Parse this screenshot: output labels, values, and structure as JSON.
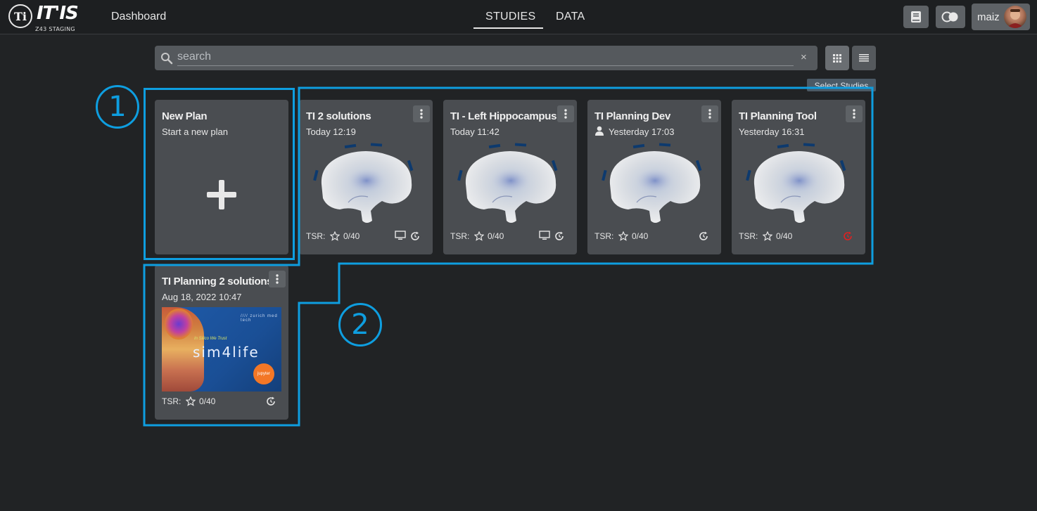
{
  "header": {
    "logo_sub": "Z43 STAGING",
    "logo_mark": "Ti",
    "logo_text": "IT'IS",
    "dashboard_label": "Dashboard",
    "tabs": [
      {
        "label": "STUDIES",
        "active": true
      },
      {
        "label": "DATA",
        "active": false
      }
    ],
    "user_name": "maiz"
  },
  "search": {
    "placeholder": "search",
    "value": "",
    "clear_label": "×"
  },
  "view": {
    "tooltip": "Select Studies",
    "mode": "grid"
  },
  "new_plan": {
    "title": "New Plan",
    "subtitle": "Start a new plan"
  },
  "studies": [
    {
      "title": "TI 2 solutions",
      "date": "Today 12:19",
      "tsr_label": "TSR:",
      "tsr": "0/40",
      "shared": false,
      "monitor": true,
      "status_color": "#e6e6e6"
    },
    {
      "title": "TI - Left Hippocampus",
      "date": "Today 11:42",
      "tsr_label": "TSR:",
      "tsr": "0/40",
      "shared": false,
      "monitor": true,
      "status_color": "#e6e6e6"
    },
    {
      "title": "TI Planning Dev",
      "date": "Yesterday 17:03",
      "tsr_label": "TSR:",
      "tsr": "0/40",
      "shared": true,
      "monitor": false,
      "status_color": "#e6e6e6"
    },
    {
      "title": "TI Planning Tool",
      "date": "Yesterday 16:31",
      "tsr_label": "TSR:",
      "tsr": "0/40",
      "shared": false,
      "monitor": false,
      "status_color": "#e02020"
    },
    {
      "title": "TI Planning 2 solutions",
      "date": "Aug 18, 2022 10:47",
      "tsr_label": "TSR:",
      "tsr": "0/40",
      "shared": false,
      "monitor": false,
      "status_color": "#e6e6e6"
    }
  ],
  "sim4life_thumb": {
    "brand": "//// zurich med tech",
    "tagline": "In Silico We Trust",
    "logo": "sim4life",
    "badge": "jupyter"
  },
  "annotations": [
    {
      "number": "1"
    },
    {
      "number": "2"
    }
  ],
  "colors": {
    "annotation": "#0e9ee0",
    "background": "#212325",
    "card": "#4a4d51",
    "status_error": "#e02020"
  }
}
